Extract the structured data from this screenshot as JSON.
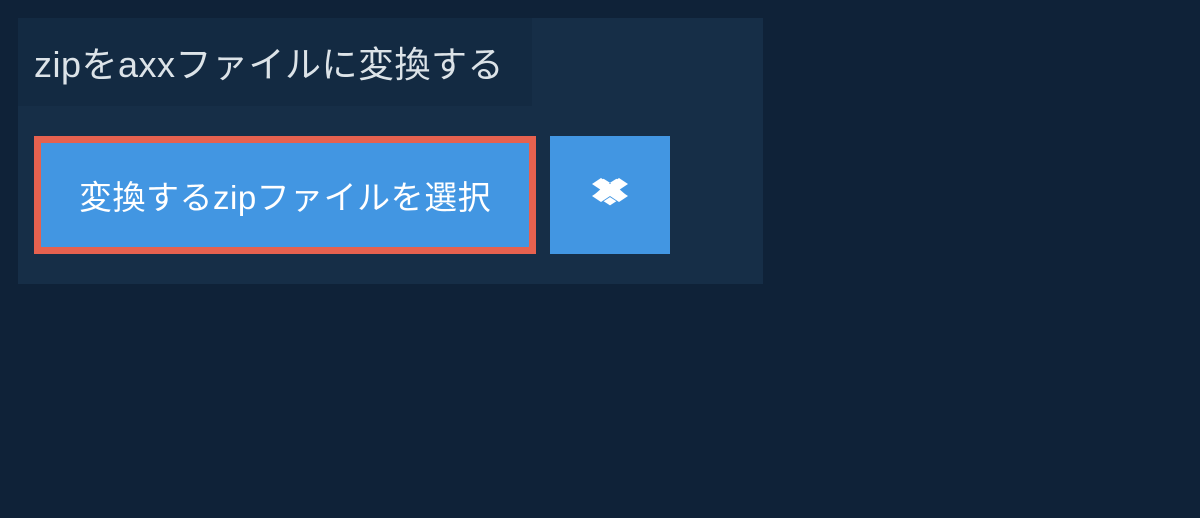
{
  "title": "zipをaxxファイルに変換する",
  "buttons": {
    "select_file": "変換するzipファイルを選択"
  },
  "colors": {
    "background": "#0f2238",
    "panel": "#162e47",
    "title_block": "#132a42",
    "button_primary": "#4296e2",
    "button_border": "#e6614f"
  }
}
